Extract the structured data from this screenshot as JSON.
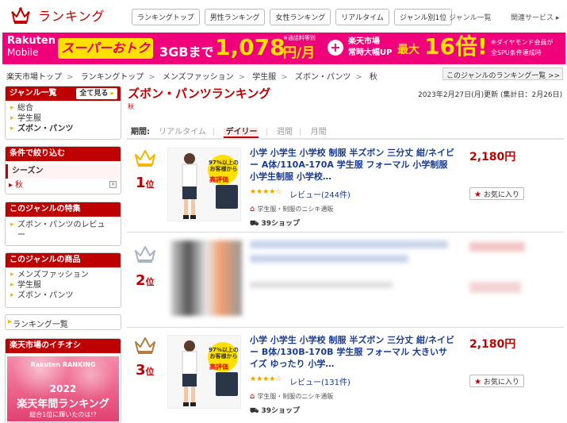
{
  "header": {
    "title": "ランキング",
    "nav_buttons": [
      "ランキングトップ",
      "男性ランキング",
      "女性ランキング",
      "リアルタイム",
      "ジャンル別1位"
    ],
    "genre_list_link": "ジャンル一覧",
    "related_link": "関連サービス ▸"
  },
  "banner": {
    "brand_line1": "Rakuten",
    "brand_line2": "Mobile",
    "super_deal": "スーパーおトク",
    "plan": "3GBまで",
    "price": "1,078",
    "unit": "円/月",
    "price_note": "※通話料等別",
    "plus": "+",
    "ichiba_line1": "楽天市場",
    "ichiba_line2": "常時大幅UP",
    "max": "最大",
    "multiplier": "16倍!",
    "dia_line1": "※ダイヤモンド会員が",
    "dia_line2": "全SPU条件達成時"
  },
  "breadcrumb": [
    "楽天市場トップ",
    "ランキングトップ",
    "メンズファッション",
    "学生服",
    "ズボン・パンツ",
    "秋"
  ],
  "genre_ranking_link": "このジャンルのランキング一覧 >>",
  "sidebar": {
    "genre_list": {
      "heading": "ジャンル一覧",
      "see_all": "全て見る",
      "items": [
        "総合",
        "学生服",
        "ズボン・パンツ"
      ]
    },
    "conditions": {
      "heading": "条件で絞り込む",
      "season_label": "シーズン",
      "selected": "秋",
      "clear": "×"
    },
    "features": {
      "heading": "このジャンルの特集",
      "items": [
        "ズボン・パンツのレビュー"
      ]
    },
    "products": {
      "heading": "このジャンルの商品",
      "items": [
        "メンズファッション",
        "学生服",
        "ズボン・パンツ"
      ]
    },
    "ranking_list": "ランキング一覧",
    "recommend": {
      "heading": "楽天市場のイチオシ",
      "small": "Rakuten RANKING",
      "year": "2022",
      "big": "楽天年間ランキング",
      "sub": "総合1位に輝いたのは!?"
    }
  },
  "main": {
    "title": "ズボン・パンツランキング",
    "subtitle": "秋",
    "updated": "2023年2月27日(月)更新 (集計日：2月26日)",
    "period": {
      "label": "期間:",
      "options": [
        "リアルタイム",
        "デイリー",
        "週間",
        "月間"
      ],
      "active": "デイリー"
    },
    "items": [
      {
        "rank": "1",
        "rank_suffix": "位",
        "title": "小学 小学生 小学校 制服 半ズボン 三分丈 紺/ネイビー A体/110A-170A 学生服 フォーマル 小学制服 小学生制服 小学校…",
        "price": "2,180円",
        "stars": "★★★★☆",
        "review": "レビュー(244件)",
        "shop": "学生服・制服のニシキ通販",
        "shop_count": "39ショップ",
        "fav": "お気に入り",
        "badge_text": "97%以上の お客様から",
        "praise": "高評価",
        "crown_color": "#f4b400"
      },
      {
        "rank": "2",
        "rank_suffix": "位",
        "crown_color": "#a9b4c2"
      },
      {
        "rank": "3",
        "rank_suffix": "位",
        "title": "小学 小学生 小学校 制服 半ズボン 三分丈 紺/ネイビー B体/130B-170B 学生服 フォーマル 大きいサイズ ゆったり 小学…",
        "price": "2,180円",
        "stars": "★★★★☆",
        "review": "レビュー(131件)",
        "shop": "学生服・制服のニシキ通販",
        "shop_count": "39ショップ",
        "fav": "お気に入り",
        "badge_text": "97%以上の お客様から",
        "praise": "高評価",
        "crown_color": "#b07f3f"
      }
    ]
  }
}
